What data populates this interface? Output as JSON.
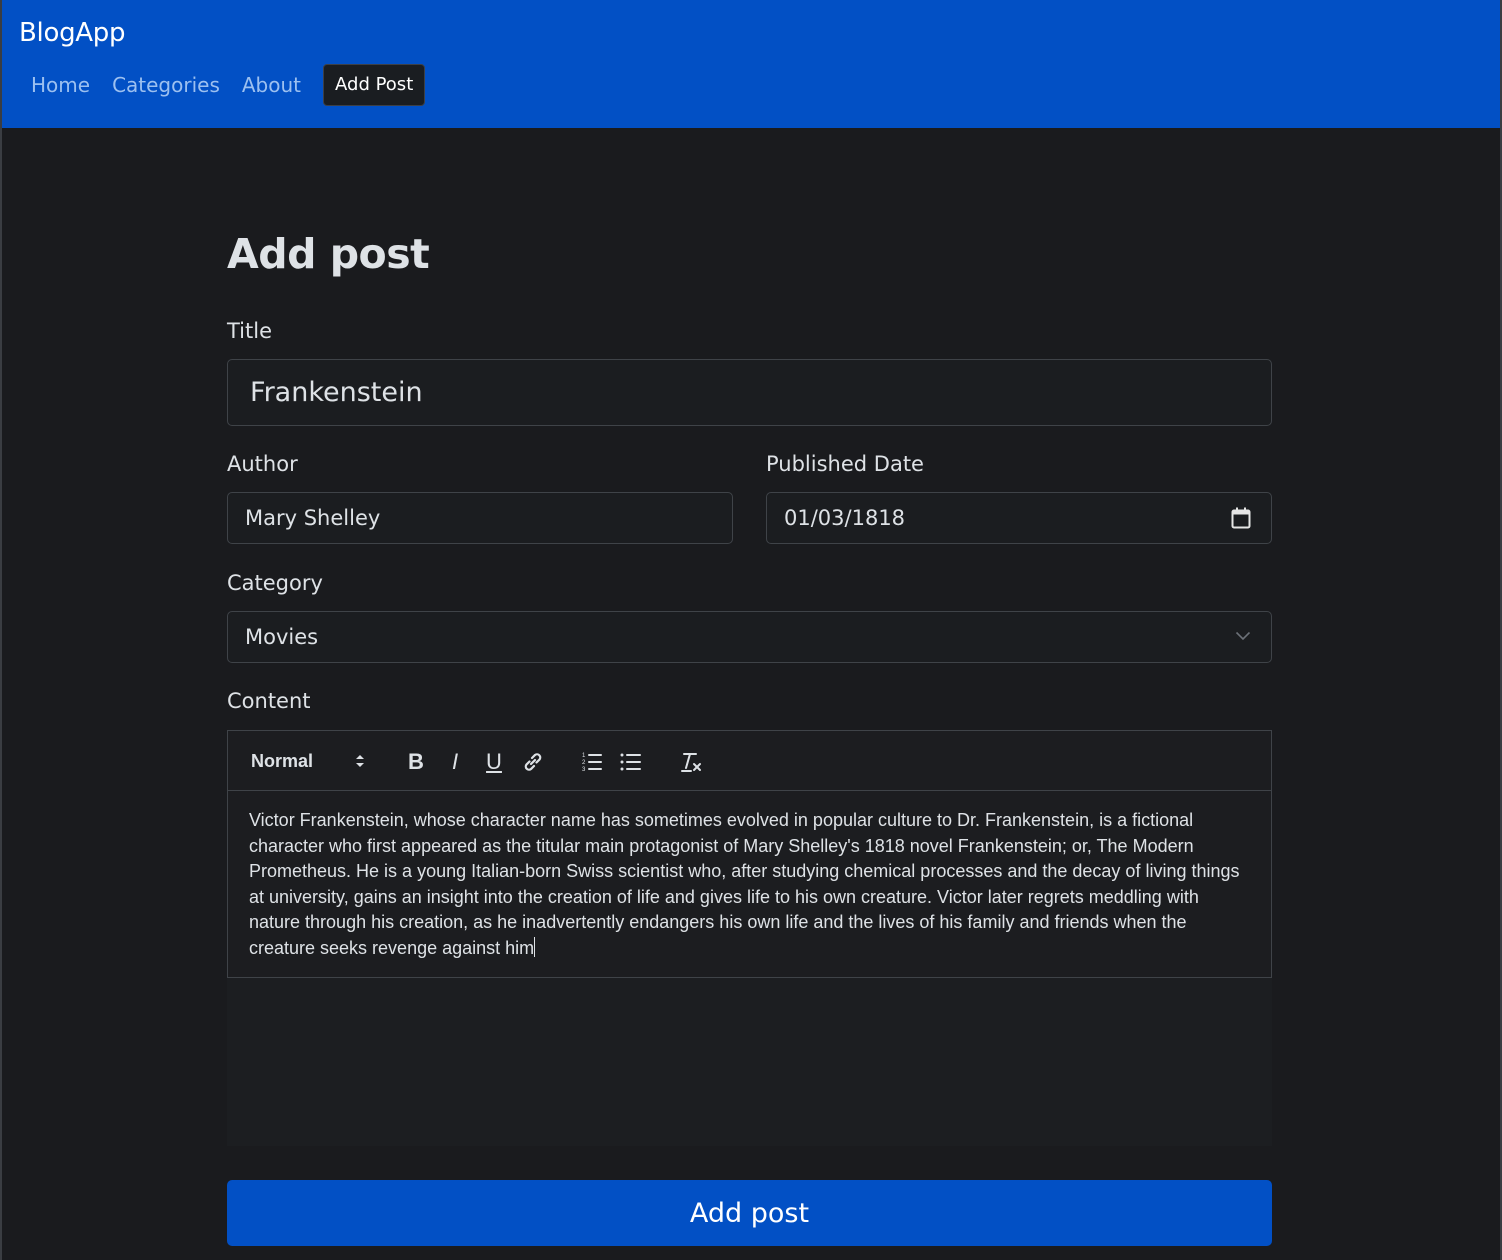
{
  "navbar": {
    "brand": "BlogApp",
    "links": [
      "Home",
      "Categories",
      "About"
    ],
    "active_link": "Add Post"
  },
  "page": {
    "title": "Add post"
  },
  "form": {
    "title": {
      "label": "Title",
      "value": "Frankenstein"
    },
    "author": {
      "label": "Author",
      "value": "Mary Shelley"
    },
    "published_date": {
      "label": "Published Date",
      "value": "01/03/1818"
    },
    "category": {
      "label": "Category",
      "selected": "Movies"
    },
    "content": {
      "label": "Content",
      "toolbar": {
        "format": "Normal",
        "buttons": [
          "bold-icon",
          "italic-icon",
          "underline-icon",
          "link-icon",
          "ordered-list-icon",
          "bullet-list-icon",
          "clear-format-icon"
        ]
      },
      "text": "Victor Frankenstein, whose character name has sometimes evolved in popular culture to Dr. Frankenstein, is a fictional character who first appeared as the titular main protagonist of Mary Shelley's 1818 novel Frankenstein; or, The Modern Prometheus. He is a young Italian-born Swiss scientist who, after studying chemical processes and the decay of living things at university, gains an insight into the creation of life and gives life to his own creature. Victor later regrets meddling with nature through his creation, as he inadvertently endangers his own life and the lives of his family and friends when the creature seeks revenge against him"
    },
    "submit_label": "Add post"
  },
  "colors": {
    "brand": "#0250c5",
    "background": "#1a1b1e",
    "input_border": "#3f4348",
    "text": "#dee2e6"
  }
}
